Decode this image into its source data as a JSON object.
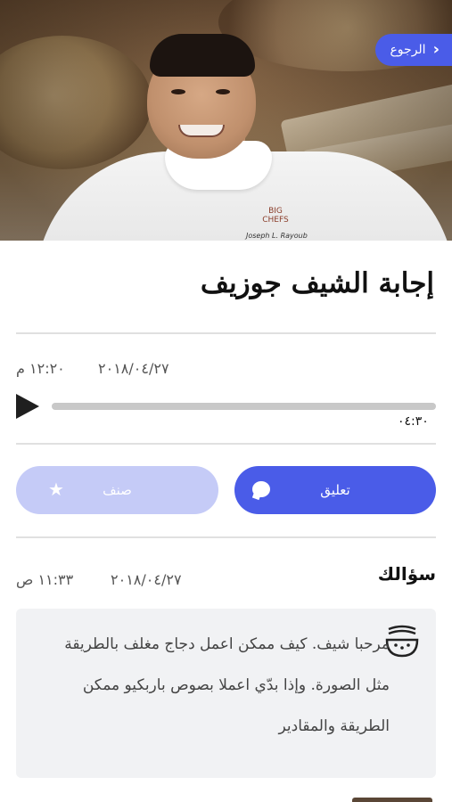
{
  "header": {
    "back_label": "الرجوع",
    "image_caption_logo": [
      "BIG",
      "CHEFS"
    ],
    "image_caption_sign": "Joseph L. Rayoub"
  },
  "answer": {
    "title": "إجابة الشيف جوزيف",
    "date": "٢٠١٨/٠٤/٢٧",
    "time": "١٢:٢٠ م",
    "duration": "٠٤:٣٠",
    "progress": 0
  },
  "actions": {
    "comment_label": "تعليق",
    "rate_label": "صنف"
  },
  "question": {
    "heading": "سؤالك",
    "date": "٢٠١٨/٠٤/٢٧",
    "time": "١١:٣٣ ص",
    "text": "مرحبا شيف. كيف ممكن اعمل دجاج مغلف بالطريقة مثل الصورة. وإذا بدّي اعملا بصوص باربكيو ممكن الطريقة  والمقادير"
  },
  "colors": {
    "accent": "#4a5ce8",
    "accent_light": "#c5cbf7",
    "question_bg": "#f1f2f4"
  },
  "icons": {
    "back": "chevron-left-icon",
    "play": "play-icon",
    "comment": "comment-bubble-icon",
    "rate": "star-icon",
    "question": "food-bowl-icon"
  }
}
